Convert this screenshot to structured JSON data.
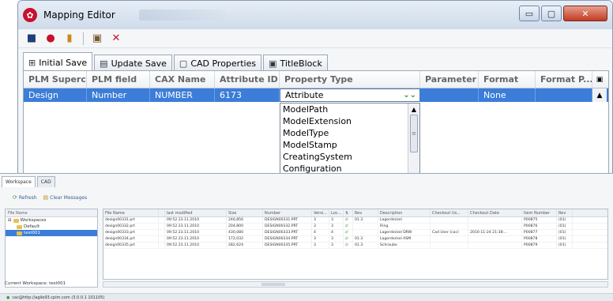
{
  "window": {
    "title": "Mapping Editor",
    "controls": {
      "minimize": "▭",
      "maximize": "▢",
      "close": "✕"
    }
  },
  "toolbar": {
    "save_icon": "■",
    "stop_icon": "●",
    "lock_icon": "▮",
    "user_icon": "▣",
    "delete_icon": "✕"
  },
  "tabs": [
    {
      "label": "Initial Save",
      "icon": "⊞"
    },
    {
      "label": "Update Save",
      "icon": "▤"
    },
    {
      "label": "CAD Properties",
      "icon": "▢"
    },
    {
      "label": "TitleBlock",
      "icon": "▣"
    }
  ],
  "grid": {
    "headers": [
      "PLM Superc...",
      "PLM field",
      "CAX Name",
      "Attribute ID",
      "Property Type",
      "Parameter",
      "Format",
      "Format P..."
    ],
    "header_menu_icon": "▣",
    "row": {
      "plm_superclass": "Design",
      "plm_field": "Number",
      "cax_name": "NUMBER",
      "attribute_id": "6173",
      "property_type": "Attribute",
      "parameter": "",
      "format": "None",
      "format_p": ""
    },
    "scroll_up": "▲"
  },
  "dropdown": {
    "options": [
      "ModelPath",
      "ModelExtension",
      "ModelType",
      "ModelStamp",
      "CreatingSystem",
      "Configuration"
    ],
    "scroll_up": "▲",
    "thumb_grip": "≡"
  },
  "workspace": {
    "tabs": [
      "Workspace",
      "CAD"
    ],
    "refresh_label": "Refresh",
    "clear_label": "Clear Messages",
    "tree_header": "File Name",
    "tree": [
      "Workspaces",
      "Default",
      "test001"
    ],
    "current_workspace": "Current Workspace: test001",
    "columns": [
      "File Name",
      "",
      "last modified",
      "Size",
      "Number",
      "Versi...",
      "Loc...",
      "⇅",
      "Rev",
      "Description",
      "Checkout Us...",
      "Checkout Date",
      "Item Number",
      "Rev"
    ],
    "rows": [
      [
        "design00331.prt",
        "",
        "09:52 23.11.2010",
        "246,856",
        "DESIGN00331.PRT",
        "3",
        "3",
        "⇄",
        "01.3",
        "Lagerdeckel",
        "",
        "",
        "P00875",
        "(01)"
      ],
      [
        "design00332.prt",
        "",
        "09:52 23.11.2010",
        "204,800",
        "DESIGN00332.PRT",
        "3",
        "3",
        "⇄",
        "",
        "Ring",
        "",
        "",
        "P00876",
        "(01)"
      ],
      [
        "design00333.prt",
        "",
        "09:52 23.11.2010",
        "430,080",
        "DESIGN00333.PRT",
        "4",
        "4",
        "⇄",
        "",
        "Lagerdeckel DRW",
        "Cad User (cac)",
        "2010-11-24 21:38:...",
        "P00877",
        "(01)"
      ],
      [
        "design00334.prt",
        "",
        "09:52 23.11.2010",
        "172,032",
        "DESIGN00334.PRT",
        "3",
        "3",
        "⇄",
        "01.3",
        "Lagerdeckel ASM",
        "",
        "",
        "P00878",
        "(01)"
      ],
      [
        "design00335.prt",
        "",
        "09:52 23.11.2010",
        "282,624",
        "DESIGN00335.PRT",
        "3",
        "3",
        "⇄",
        "01.3",
        "Schraube",
        "",
        "",
        "P00879",
        "(01)"
      ]
    ],
    "status": "cac@http://agile93.cplm.com (3.0.0.1 101105)"
  }
}
